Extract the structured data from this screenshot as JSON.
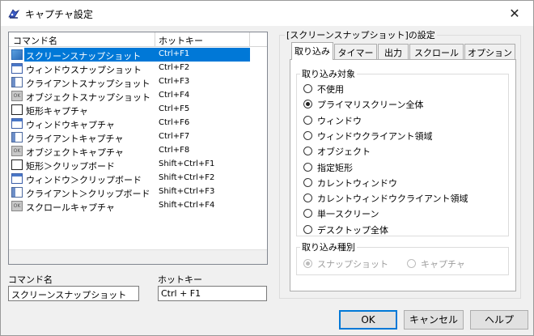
{
  "window": {
    "title": "キャプチャ設定",
    "close_glyph": "✕"
  },
  "list": {
    "columns": [
      "コマンド名",
      "ホットキー"
    ],
    "rows": [
      {
        "name": "スクリーンスナップショット",
        "key": "Ctrl+F1",
        "icon": "screen-icon",
        "selected": true
      },
      {
        "name": "ウィンドウスナップショット",
        "key": "Ctrl+F2",
        "icon": "window-icon"
      },
      {
        "name": "クライアントスナップショット",
        "key": "Ctrl+F3",
        "icon": "client-icon"
      },
      {
        "name": "オブジェクトスナップショット",
        "key": "Ctrl+F4",
        "icon": "object-icon"
      },
      {
        "name": "矩形キャプチャ",
        "key": "Ctrl+F5",
        "icon": "rectangle-icon"
      },
      {
        "name": "ウィンドウキャプチャ",
        "key": "Ctrl+F6",
        "icon": "window-icon"
      },
      {
        "name": "クライアントキャプチャ",
        "key": "Ctrl+F7",
        "icon": "client-icon"
      },
      {
        "name": "オブジェクトキャプチャ",
        "key": "Ctrl+F8",
        "icon": "object-icon"
      },
      {
        "name": "矩形＞クリップボード",
        "key": "Shift+Ctrl+F1",
        "icon": "rectangle-icon"
      },
      {
        "name": "ウィンドウ＞クリップボード",
        "key": "Shift+Ctrl+F2",
        "icon": "window-icon"
      },
      {
        "name": "クライアント＞クリップボード",
        "key": "Shift+Ctrl+F3",
        "icon": "client-icon"
      },
      {
        "name": "スクロールキャプチャ",
        "key": "Shift+Ctrl+F4",
        "icon": "object-icon"
      }
    ]
  },
  "fields": {
    "command_label": "コマンド名",
    "command_value": "スクリーンスナップショット",
    "hotkey_label": "ホットキー",
    "hotkey_value": "Ctrl + F1"
  },
  "settings": {
    "legend": "[スクリーンスナップショット]の設定",
    "tabs": [
      "取り込み",
      "タイマー",
      "出力",
      "スクロール",
      "オプション"
    ],
    "active_tab": 0,
    "target_group": {
      "legend": "取り込み対象",
      "options": [
        "不使用",
        "プライマリスクリーン全体",
        "ウィンドウ",
        "ウィンドウクライアント領域",
        "オブジェクト",
        "指定矩形",
        "カレントウィンドウ",
        "カレントウィンドウクライアント領域",
        "単一スクリーン",
        "デスクトップ全体"
      ],
      "selected": 1
    },
    "type_group": {
      "legend": "取り込み種別",
      "options": [
        "スナップショット",
        "キャプチャ"
      ],
      "selected": 0,
      "disabled": true
    }
  },
  "buttons": {
    "ok": "OK",
    "cancel": "キャンセル",
    "help": "ヘルプ"
  }
}
